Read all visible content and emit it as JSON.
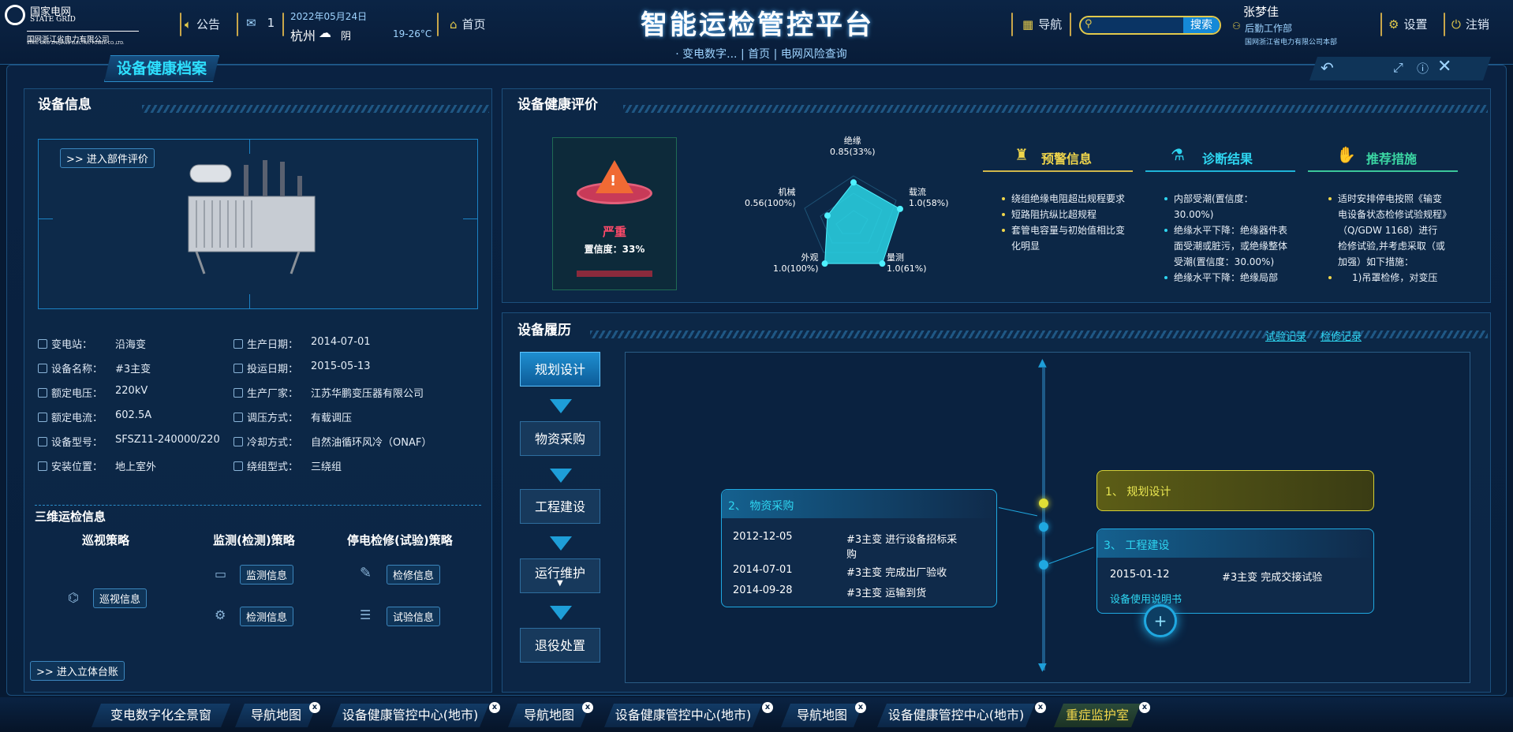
{
  "header": {
    "logo": {
      "line1": "国家电网",
      "line2": "STATE GRID",
      "line3": "国网浙江省电力有限公司",
      "line4": "STATE GRID ZHEJIANG ELECTRIC POWER CO.,LTD."
    },
    "announcement": "公告",
    "mail_count": "1",
    "date": "2022年05月24日",
    "city": "杭州",
    "weather": "阴",
    "temp": "19-26°C",
    "home": "首页",
    "title": "智能运检管控平台",
    "subnav": [
      "· 变电数字...",
      "首页",
      "电网风险查询"
    ],
    "nav": "导航",
    "search_btn": "搜索",
    "search_placeholder": "",
    "user": "张梦佳",
    "user_dept": "后勤工作部",
    "user_org": "国网浙江省电力有限公司本部",
    "settings": "设置",
    "logout": "注销"
  },
  "page_title": "设备健康档案",
  "device_info": {
    "title": "设备信息",
    "enter_parts": ">> 进入部件评价",
    "left": [
      {
        "label": "变电站：",
        "value": "沿海变"
      },
      {
        "label": "设备名称：",
        "value": "#3主变"
      },
      {
        "label": "额定电压：",
        "value": "220kV"
      },
      {
        "label": "额定电流：",
        "value": "602.5A"
      },
      {
        "label": "设备型号：",
        "value": "SFSZ11-240000/220"
      },
      {
        "label": "安装位置：",
        "value": "地上室外"
      }
    ],
    "right": [
      {
        "label": "生产日期：",
        "value": "2014-07-01"
      },
      {
        "label": "投运日期：",
        "value": "2015-05-13"
      },
      {
        "label": "生产厂家：",
        "value": "江苏华鹏变压器有限公司"
      },
      {
        "label": "调压方式：",
        "value": "有载调压"
      },
      {
        "label": "冷却方式：",
        "value": "自然油循环风冷（ONAF）"
      },
      {
        "label": "绕组型式：",
        "value": "三绕组"
      }
    ]
  },
  "ops": {
    "title": "三维运检信息",
    "cols": [
      "巡视策略",
      "监测(检测)策略",
      "停电检修(试验)策略"
    ],
    "btn_patrol": "巡视信息",
    "btn_monitor": "监测信息",
    "btn_detect": "检测信息",
    "btn_repair": "检修信息",
    "btn_test": "试验信息",
    "enter_ledger": ">> 进入立体台账"
  },
  "health": {
    "title": "设备健康评价",
    "level": "严重",
    "confidence": "置信度：33%",
    "radar": [
      {
        "name": "绝缘",
        "val": "0.85(33%)",
        "v": 0.85
      },
      {
        "name": "载流",
        "val": "1.0(58%)",
        "v": 1.0
      },
      {
        "name": "量测",
        "val": "1.0(61%)",
        "v": 1.0
      },
      {
        "name": "外观",
        "val": "1.0(100%)",
        "v": 1.0
      },
      {
        "name": "机械",
        "val": "0.56(100%)",
        "v": 0.56
      }
    ],
    "warning": {
      "title": "预警信息",
      "items": [
        "绕组绝缘电阻超出规程要求",
        "短路阻抗纵比超规程",
        "套管电容量与初始值相比变化明显"
      ]
    },
    "diagnosis": {
      "title": "诊断结果",
      "items": [
        "内部受潮(置信度：30.00%)",
        "绝缘水平下降：绝缘器件表面受潮或脏污，或绝缘整体受潮(置信度：30.00%)",
        "绝缘水平下降：绝缘局部"
      ]
    },
    "measures": {
      "title": "推荐措施",
      "items": [
        "适时安排停电按照《输变电设备状态检修试验规程》（Q/GDW 1168）进行检修试验,并考虑采取（或加强）如下措施：",
        "1)吊罩检修，对变压"
      ]
    }
  },
  "history": {
    "title": "设备履历",
    "link_test": "试验记录",
    "link_repair": "检修记录",
    "flow": [
      "规划设计",
      "物资采购",
      "工程建设",
      "运行维护",
      "退役处置"
    ],
    "card1": {
      "title": "1、 规划设计"
    },
    "card2": {
      "title": "2、 物资采购",
      "rows": [
        {
          "date": "2012-12-05",
          "text": "#3主变 进行设备招标采购"
        },
        {
          "date": "2014-07-01",
          "text": "#3主变 完成出厂验收"
        },
        {
          "date": "2014-09-28",
          "text": "#3主变 运输到货"
        }
      ]
    },
    "card3": {
      "title": "3、 工程建设",
      "rows": [
        {
          "date": "2015-01-12",
          "text": "#3主变 完成交接试验"
        }
      ],
      "link": "设备使用说明书"
    }
  },
  "tabs": [
    "变电数字化全景窗",
    "导航地图",
    "设备健康管控中心(地市)",
    "导航地图",
    "设备健康管控中心(地市)",
    "导航地图",
    "设备健康管控中心(地市)",
    "重症监护室"
  ]
}
